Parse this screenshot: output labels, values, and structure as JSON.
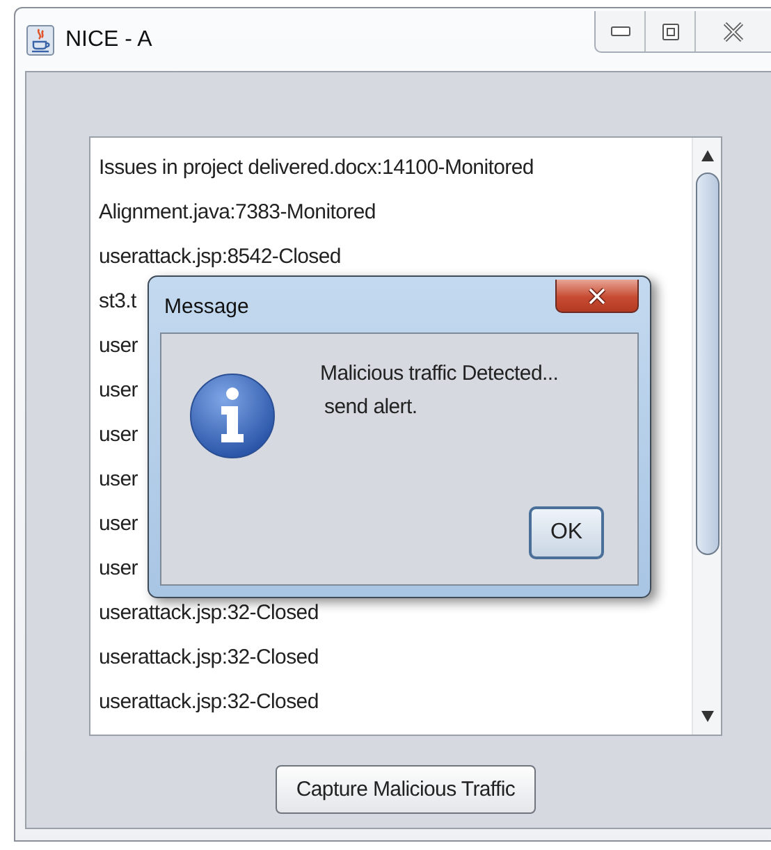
{
  "window": {
    "title": "NICE - A"
  },
  "list": {
    "items": [
      "Issues in project delivered.docx:14100-Monitored",
      "Alignment.java:7383-Monitored",
      "userattack.jsp:8542-Closed",
      "st3.t",
      "user",
      "user",
      "user",
      "user",
      "user",
      "user",
      "userattack.jsp:32-Closed",
      "userattack.jsp:32-Closed",
      "userattack.jsp:32-Closed"
    ]
  },
  "dialog": {
    "title": "Message",
    "kind": "info",
    "lines": [
      "Malicious traffic Detected...",
      "send alert."
    ],
    "button": "OK"
  },
  "buttons": [
    "Capture Malicious Traffic"
  ]
}
